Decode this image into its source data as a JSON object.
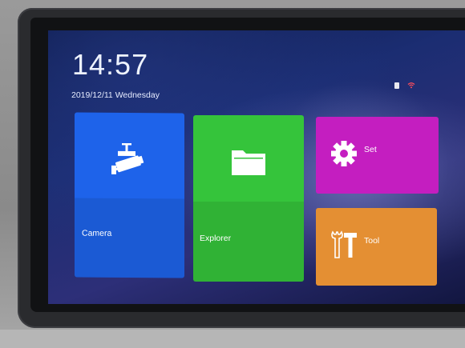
{
  "status_bar": {
    "time": "14:57",
    "date": "2019/12/11 Wednesday",
    "icons": [
      "sim-card-icon",
      "wifi-icon"
    ]
  },
  "tiles": [
    {
      "label": "Camera",
      "icon": "camera-icon",
      "color": "#1e63ea"
    },
    {
      "label": "Explorer",
      "icon": "folder-icon",
      "color": "#35c43b"
    },
    {
      "label": "Set",
      "icon": "gear-icon",
      "color": "#c41ec0"
    },
    {
      "label": "Tool",
      "icon": "tools-icon",
      "color": "#e48f33"
    }
  ],
  "colors": {
    "wifi": "#ff4d5a",
    "wallpaper": "#1b2d72"
  }
}
